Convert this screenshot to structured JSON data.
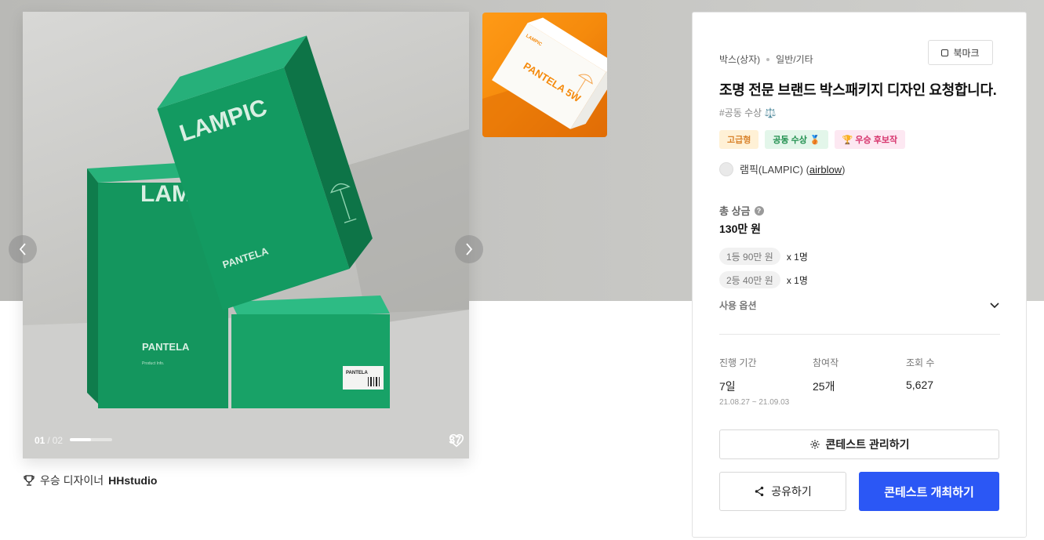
{
  "gallery": {
    "current": "01",
    "separator": "/",
    "total": "02",
    "progress": 0.5,
    "likes": "37",
    "box_brand": "LAMPIC",
    "box_product": "PANTELA",
    "box_subtext": "Product Info.",
    "thumb_brand": "LAMPIC",
    "thumb_product": "PANTELA 5W"
  },
  "winner": {
    "label": "우승 디자이너",
    "name": "HHstudio"
  },
  "panel": {
    "category": "박스(상자)",
    "subcategory": "일반/기타",
    "bookmark_label": "북마크",
    "title": "조명 전문 브랜드 박스패키지 디자인 요청합니다.",
    "hashtag": "#공동 수상 ⚖️",
    "badges": {
      "premium": "고급형",
      "joint": "공동 수상 🥉",
      "candidate": "🏆 우승 후보작"
    },
    "host_name": "램픽(LAMPIC) (",
    "host_id": "airblow",
    "host_close": ")",
    "prize_label": "총 상금",
    "prize_total": "130만 원",
    "prizes": [
      {
        "rank": "1등 90만 원",
        "count": "x 1명"
      },
      {
        "rank": "2등 40만 원",
        "count": "x 1명"
      }
    ],
    "options_label": "사용 옵션",
    "stats": {
      "period_label": "진행 기간",
      "period_value": "7일",
      "period_dates": "21.08.27 ~ 21.09.03",
      "entries_label": "참여작",
      "entries_value": "25개",
      "views_label": "조회 수",
      "views_value": "5,627"
    },
    "manage_label": "콘테스트 관리하기",
    "share_label": "공유하기",
    "open_label": "콘테스트 개최하기"
  },
  "colors": {
    "primary": "#2b57f5",
    "box_green": "#12905a",
    "thumb_orange": "#f58a0c"
  }
}
